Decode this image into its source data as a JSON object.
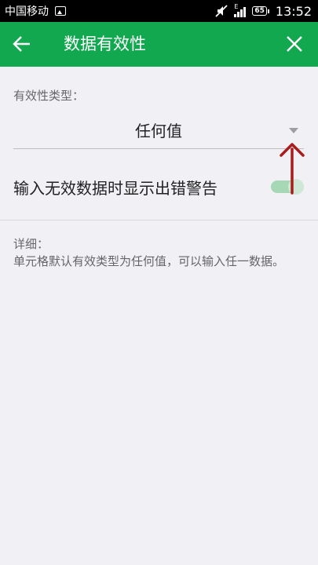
{
  "status_bar": {
    "carrier": "中国移动",
    "signal_type": "E",
    "battery": "65",
    "time": "13:52",
    "icons": [
      "image-icon",
      "mute-icon",
      "signal-icon",
      "battery-icon"
    ]
  },
  "app_bar": {
    "title": "数据有效性",
    "back_icon": "arrow-left-icon",
    "close_icon": "close-icon",
    "color": "#11a84f"
  },
  "validity": {
    "type_label": "有效性类型：",
    "type_value": "任何值",
    "warning_label": "输入无效数据时显示出错警告",
    "warning_enabled": true,
    "toggle_color": "#a6d8b6"
  },
  "details": {
    "heading": "详细：",
    "text": "单元格默认有效类型为任何值，可以输入任一数据。"
  },
  "annotation": {
    "icon": "red-arrow-annotation",
    "color": "#a81c1c"
  }
}
